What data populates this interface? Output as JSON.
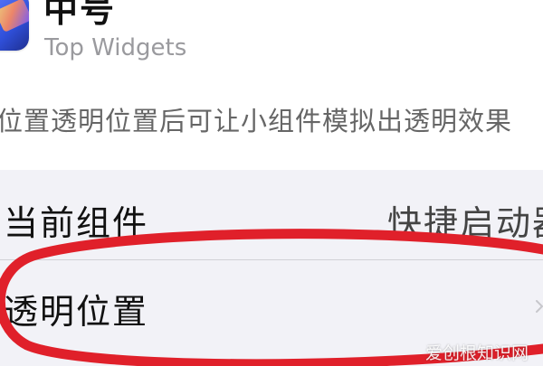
{
  "app": {
    "title": "中号",
    "subtitle": "Top Widgets",
    "icon": "widget-app-icon"
  },
  "description": "位置透明位置后可让小组件模拟出透明效果",
  "settings": {
    "rows": [
      {
        "label": "当前组件",
        "value": "快捷启动器"
      },
      {
        "label": "透明位置",
        "value": ""
      }
    ]
  },
  "annotation": {
    "shape": "ellipse",
    "color": "#e0202a",
    "target": "透明位置"
  },
  "watermark": "爱创根知识网",
  "colors": {
    "background": "#f2f2f7",
    "surface": "#ffffff",
    "text": "#111111",
    "secondary_text": "#9a9a9e",
    "annotation": "#e0202a"
  }
}
